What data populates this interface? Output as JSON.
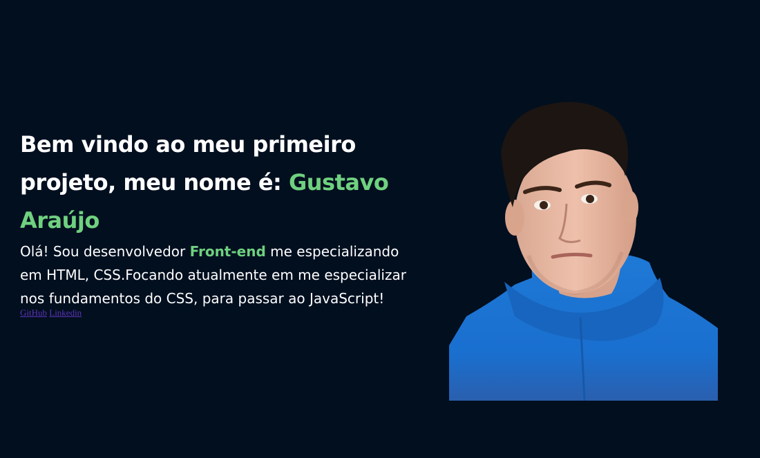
{
  "intro": {
    "prefix": "Bem vindo ao meu primeiro projeto, meu nome é: ",
    "name": "Gustavo Araújo"
  },
  "bio": {
    "before": "Olá! Sou desenvolvedor ",
    "highlight": "Front-end",
    "after": " me especializando em HTML, CSS.Focando atualmente em me especializar nos fundamentos do CSS, para passar ao JavaScript!"
  },
  "links": {
    "github": "GitHub",
    "linkedin": "Linkedin"
  },
  "colors": {
    "background": "#020f1f",
    "accent": "#6fd17f",
    "text": "#ffffff",
    "link": "#5b33b8"
  },
  "photo": {
    "icon": "profile-photo"
  }
}
